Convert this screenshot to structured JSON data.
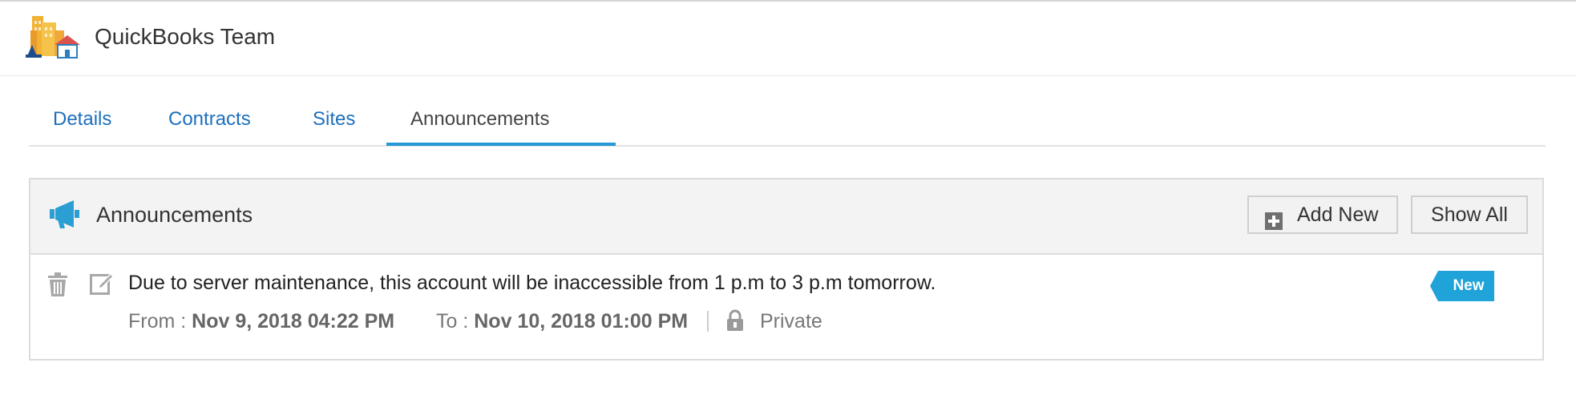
{
  "header": {
    "title": "QuickBooks Team",
    "logo_icon": "buildings-icon"
  },
  "tabs": [
    {
      "label": "Details",
      "active": false
    },
    {
      "label": "Contracts",
      "active": false
    },
    {
      "label": "Sites",
      "active": false
    },
    {
      "label": "Announcements",
      "active": true
    }
  ],
  "announcements_panel": {
    "title": "Announcements",
    "title_icon": "megaphone-icon",
    "add_new_label": "Add New",
    "show_all_label": "Show All",
    "items": [
      {
        "message": "Due to server maintenance, this account will be inaccessible from 1 p.m to 3 p.m tomorrow.",
        "from_label": "From :",
        "from_value": "Nov 9, 2018 04:22 PM",
        "to_label": "To :",
        "to_value": "Nov 10, 2018 01:00 PM",
        "visibility": "Private",
        "badge": "New"
      }
    ]
  },
  "colors": {
    "link_blue": "#1d6fbd",
    "tab_underline": "#2699d6",
    "badge_blue": "#1fa3d8",
    "icon_blue": "#2b9fd3"
  }
}
